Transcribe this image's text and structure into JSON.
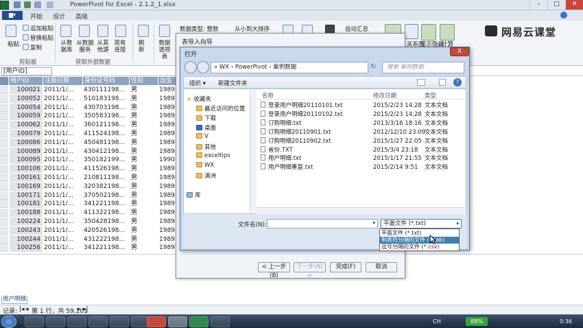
{
  "window": {
    "title": "PowerPivot for Excel - 2.1.2_1.xlsx"
  },
  "ribbon": {
    "tabs": [
      "开始",
      "设计",
      "高级"
    ],
    "clipboard": {
      "paste": "粘贴",
      "append": "追加粘贴",
      "replace": "替换粘贴",
      "copy": "复制",
      "group": "剪贴板"
    },
    "external": {
      "db": "从数据库",
      "service": "从数据服务",
      "other": "从其他源",
      "existing": "现有连接",
      "group": "获取外部数据"
    },
    "refresh": "刷新",
    "pivot": "数据透视表",
    "datatype": "数据类型: 整数",
    "sort": "从小到大排序",
    "sum": "自动汇总",
    "diagram": "关系图",
    "show": "显示隐藏",
    "calc": "计算"
  },
  "watermark": "网易云课堂",
  "namebox": "[用户ID]",
  "grid": {
    "headers": [
      "用户ID",
      "注册日期",
      "身份证号码",
      "性别",
      "出生"
    ],
    "rows": [
      [
        "100021",
        "2011/1/...",
        "430111198...",
        "男",
        "1989"
      ],
      [
        "100052",
        "2011/1/...",
        "510183198...",
        "男",
        "1989"
      ],
      [
        "100054",
        "2011/1/...",
        "430703198...",
        "男",
        "1989"
      ],
      [
        "100059",
        "2011/1/...",
        "350583198...",
        "男",
        "1989"
      ],
      [
        "100062",
        "2011/1/...",
        "360121198...",
        "男",
        "1989"
      ],
      [
        "100079",
        "2011/1/...",
        "411524198...",
        "男",
        "1989"
      ],
      [
        "100086",
        "2011/1/...",
        "450481198...",
        "男",
        "1989"
      ],
      [
        "100089",
        "2011/1/...",
        "430412198...",
        "男",
        "1989"
      ],
      [
        "100095",
        "2011/1/...",
        "350182199...",
        "男",
        "1990"
      ],
      [
        "100106",
        "2011/1/...",
        "411526198...",
        "男",
        "1989"
      ],
      [
        "100161",
        "2011/1/...",
        "210811198...",
        "男",
        "1989"
      ],
      [
        "100169",
        "2011/1/...",
        "320382198...",
        "男",
        "1989"
      ],
      [
        "100171",
        "2011/1/...",
        "370502198...",
        "男",
        "1989"
      ],
      [
        "100181",
        "2011/1/...",
        "341221198...",
        "男",
        "1989"
      ],
      [
        "100188",
        "2011/1/...",
        "411322198...",
        "男",
        "1989"
      ],
      [
        "100224",
        "2011/1/...",
        "350428198...",
        "男",
        "1989"
      ],
      [
        "100243",
        "2011/1/...",
        "420526198...",
        "男",
        "1989"
      ],
      [
        "100244",
        "2011/1/...",
        "431222198...",
        "男",
        "1989"
      ],
      [
        "100256",
        "2011/1/...",
        "341221198...",
        "男",
        "1989"
      ]
    ]
  },
  "sheet_tab": "用户明细",
  "status": {
    "record": "记录:",
    "position": "第 1 行，共 59,101"
  },
  "wizard": {
    "title": "表导入向导",
    "back": "< 上一步(B)",
    "next": "下一步(N) >",
    "finish": "完成(F)",
    "cancel": "取消"
  },
  "open_dialog": {
    "title": "打开",
    "close": "X",
    "path": "« WX › PowerPivot › 案例数据",
    "search_placeholder": "搜索 案例数据",
    "organize": "组织 ▾",
    "new_folder": "新建文件夹",
    "nav": [
      "收藏夹",
      "最近访问的位置",
      "下载",
      "桌面",
      "V",
      "其他",
      "exceltips",
      "WX",
      "满洲",
      "库"
    ],
    "columns": {
      "name": "名称",
      "date": "修改日期",
      "type": "类型"
    },
    "files": [
      {
        "name": "登录用户明细20110101.txt",
        "date": "2015/2/23 14:28",
        "type": "文本文档"
      },
      {
        "name": "登录用户明细20110102.txt",
        "date": "2015/2/23 14:28",
        "type": "文本文档"
      },
      {
        "name": "订购明细.txt",
        "date": "2013/3/16 18:16",
        "type": "文本文档"
      },
      {
        "name": "订购明细20110901.txt",
        "date": "2012/12/10 23:09",
        "type": "文本文档"
      },
      {
        "name": "订购明细20110902.txt",
        "date": "2015/1/27 22:05",
        "type": "文本文档"
      },
      {
        "name": "省份.TXT",
        "date": "2015/3/4 23:18",
        "type": "文本文档"
      },
      {
        "name": "用户明细.txt",
        "date": "2015/1/17 21:55",
        "type": "文本文档"
      },
      {
        "name": "用户明细重复.txt",
        "date": "2015/2/14 9:51",
        "type": "文本文档"
      }
    ],
    "filename_label": "文件名(N):",
    "filetype": "平面文件 (*.txt)",
    "filetype_options": [
      "平面文件 (*.txt)",
      "制表符分隔的文件 (*.tab)",
      "逗号分隔的文件 (*.csv)"
    ]
  },
  "taskbar": {
    "lang": "CH",
    "battery": "88%",
    "time": "0:36"
  },
  "colors": {
    "accent": "#1f4e8c",
    "grid_header": "#8ea3bd",
    "selection": "#3c7fb1"
  }
}
